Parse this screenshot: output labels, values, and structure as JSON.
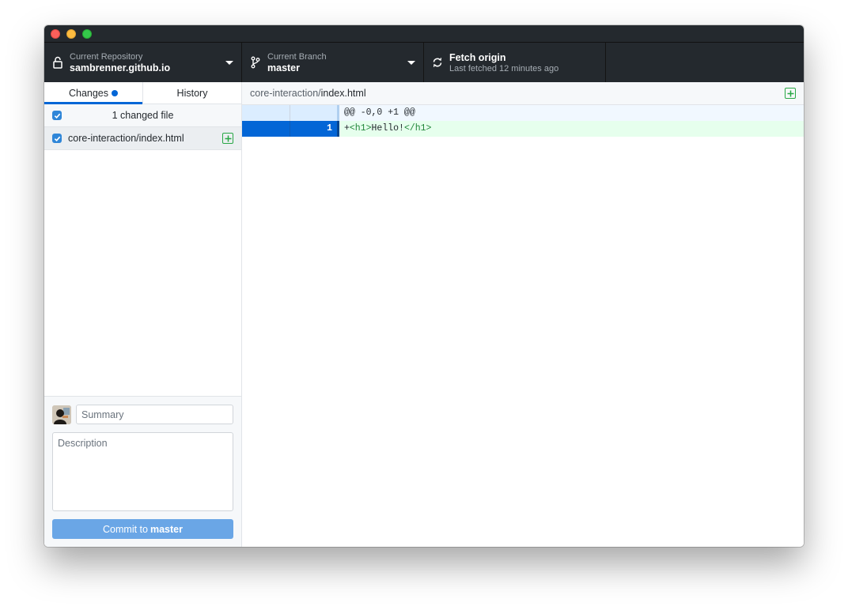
{
  "toolbar": {
    "repository": {
      "label": "Current Repository",
      "value": "sambrenner.github.io"
    },
    "branch": {
      "label": "Current Branch",
      "value": "master"
    },
    "fetch": {
      "title": "Fetch origin",
      "subtitle": "Last fetched 12 minutes ago"
    }
  },
  "sidebar": {
    "tabs": [
      {
        "label": "Changes",
        "active": true
      },
      {
        "label": "History",
        "active": false
      }
    ],
    "files_header": "1 changed file",
    "files": [
      {
        "name": "core-interaction/index.html",
        "status": "added"
      }
    ]
  },
  "commit": {
    "summary_placeholder": "Summary",
    "description_placeholder": "Description",
    "button_prefix": "Commit to",
    "button_branch": "master"
  },
  "diff": {
    "path_dir": "core-interaction/",
    "path_file": "index.html",
    "hunk_header": "@@ -0,0 +1 @@",
    "lines": [
      {
        "new_line": "1",
        "prefix": "+",
        "open_tag": "<h1>",
        "text": "Hello!",
        "close_tag": "</h1>"
      }
    ]
  },
  "colors": {
    "accent": "#0366d6",
    "added": "#28a745",
    "toolbar_bg": "#24292e"
  }
}
